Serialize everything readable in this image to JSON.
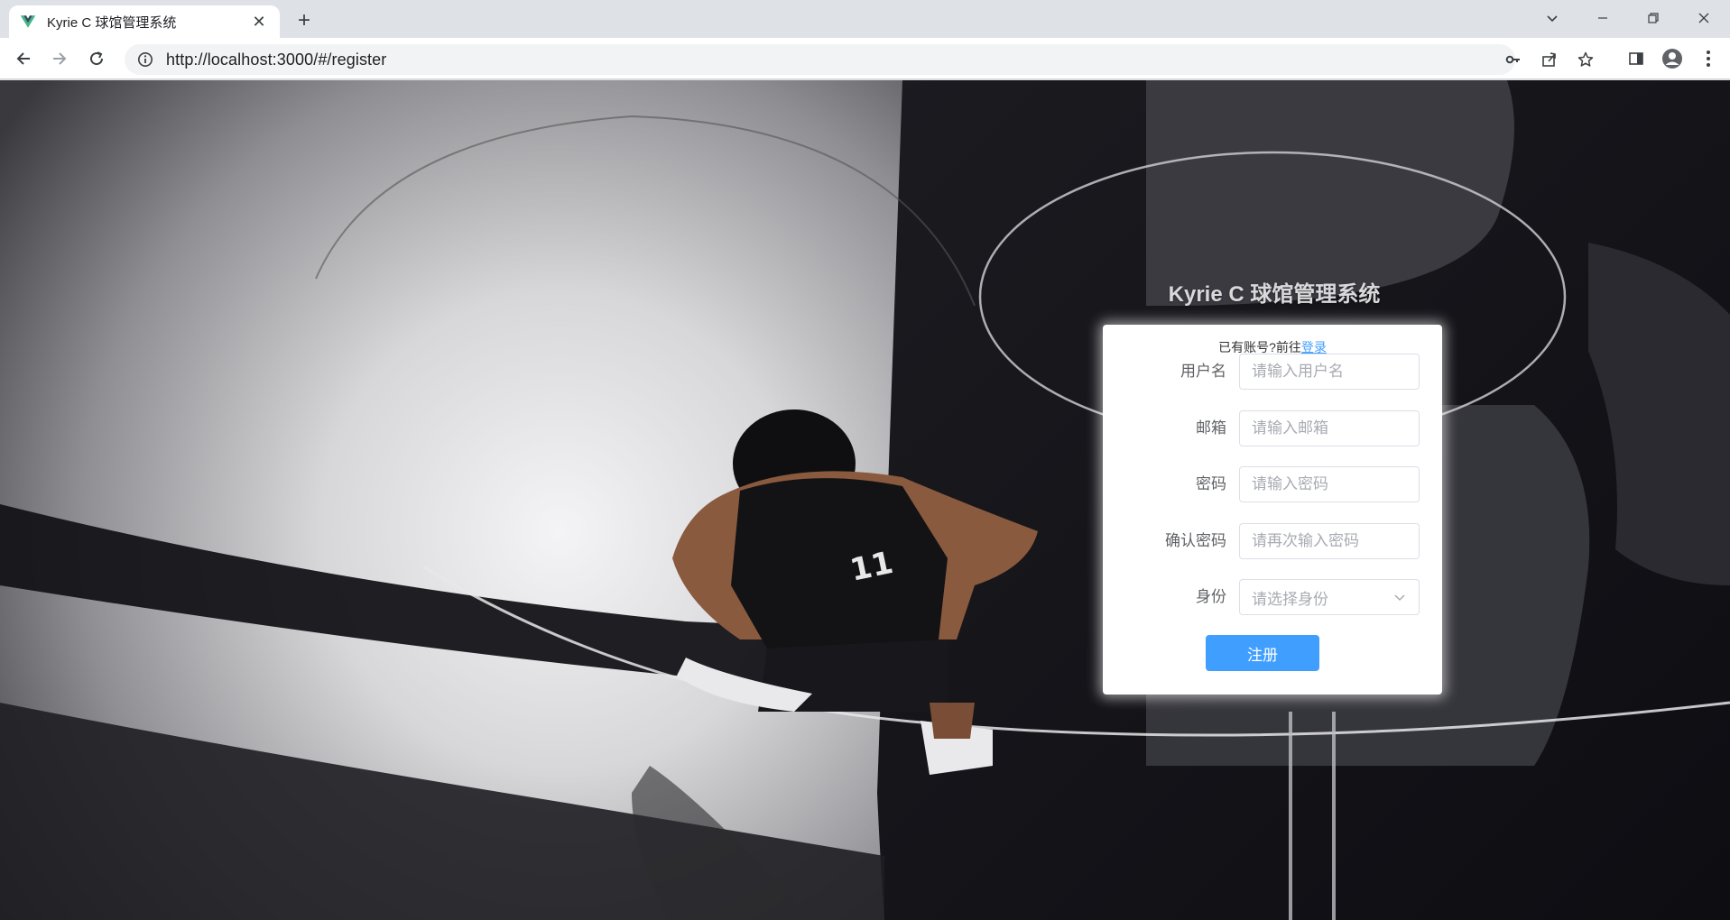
{
  "browser": {
    "tab_title": "Kyrie C 球馆管理系统",
    "url": "http://localhost:3000/#/register"
  },
  "page": {
    "title": "Kyrie C 球馆管理系统",
    "login_hint": "已有账号?前往",
    "login_link": "登录",
    "fields": [
      {
        "label": "用户名",
        "placeholder": "请输入用户名"
      },
      {
        "label": "邮箱",
        "placeholder": "请输入邮箱"
      },
      {
        "label": "密码",
        "placeholder": "请输入密码"
      },
      {
        "label": "确认密码",
        "placeholder": "请再次输入密码"
      }
    ],
    "role": {
      "label": "身份",
      "placeholder": "请选择身份"
    },
    "submit_label": "注册"
  },
  "colors": {
    "primary": "#409eff",
    "card_bg": "#ffffff"
  }
}
